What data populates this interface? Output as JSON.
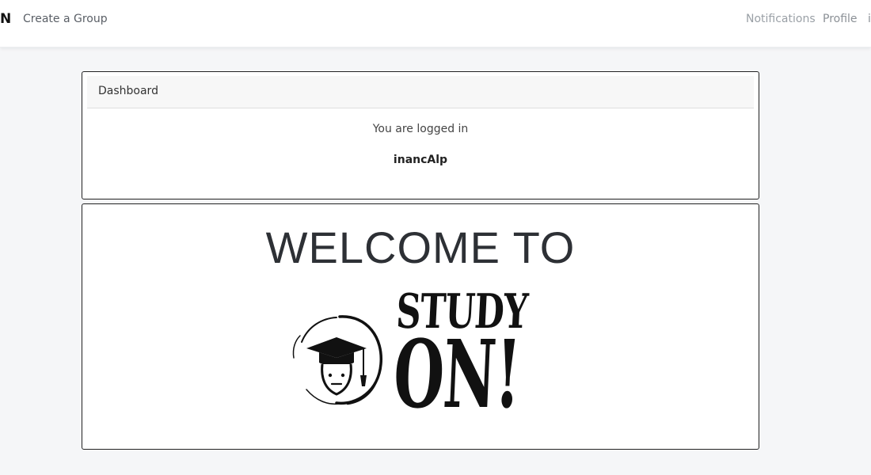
{
  "navbar": {
    "brand": "N",
    "create_group": "Create a Group",
    "notifications": "Notifications",
    "profile": "Profile",
    "user_initial": "i"
  },
  "dashboard": {
    "header": "Dashboard",
    "status": "You are logged in",
    "username": "inancAlp"
  },
  "welcome": {
    "title": "WELCOME TO",
    "logo_word_1": "STUDY",
    "logo_word_2": "ON!"
  }
}
